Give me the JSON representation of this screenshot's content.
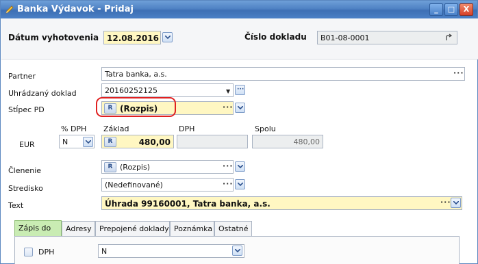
{
  "window": {
    "title": "Banka Výdavok - Pridaj",
    "minimize": "_",
    "maximize": "□",
    "close": "X"
  },
  "header": {
    "date_label": "Dátum vyhotovenia",
    "date_value": "12.08.2016",
    "doc_number_label": "Číslo dokladu",
    "doc_number_value": "B01-08-0001",
    "doc_number_icon": "redo-arrow-icon"
  },
  "form": {
    "partner_label": "Partner",
    "partner_value": "Tatra banka, a.s.",
    "paid_doc_label": "Uhrádzaný doklad",
    "paid_doc_value": "20160252125",
    "column_pd_label": "Stĺpec PD",
    "column_pd_badge": "R",
    "column_pd_value": "(Rozpis)",
    "currency_label": "EUR",
    "vat_pct_label": "% DPH",
    "vat_pct_value": "N",
    "base_label": "Základ",
    "base_badge": "R",
    "base_value": "480,00",
    "vat_label": "DPH",
    "vat_value": "",
    "total_label": "Spolu",
    "total_value": "480,00",
    "division_label": "Členenie",
    "division_badge": "R",
    "division_value": "(Rozpis)",
    "center_label": "Stredisko",
    "center_value": "(Nedefinované)",
    "text_label": "Text",
    "text_value": "Úhrada 99160001, Tatra banka, a.s.",
    "ellipsis": "···"
  },
  "tabs": [
    {
      "label": "Zápis do",
      "active": true
    },
    {
      "label": "Adresy",
      "active": false
    },
    {
      "label": "Prepojené doklady",
      "active": false
    },
    {
      "label": "Poznámka",
      "active": false
    },
    {
      "label": "Ostatné",
      "active": false
    }
  ],
  "tab_content": {
    "vat_checkbox_label": "DPH",
    "vat_select_value": "N"
  },
  "colors": {
    "title_bar": "#4f82c4",
    "highlight": "#e02020",
    "yellow_field": "#fff7c2",
    "active_tab": "#c9ecb3"
  }
}
